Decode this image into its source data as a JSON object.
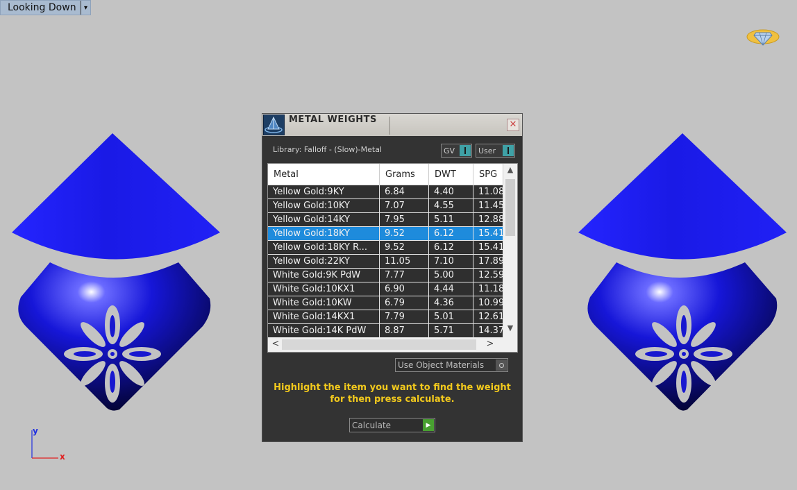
{
  "viewport": {
    "label": "Looking Down",
    "dropdown_glyph": "▾",
    "axis_x": "x",
    "axis_y": "y"
  },
  "icons": {
    "gem": "gem-icon",
    "app_logo": "app-logo-icon",
    "close": "close-icon"
  },
  "colors": {
    "object_blue": "#1a1ae6",
    "selected_row": "#1e8bdc",
    "hint_text": "#f2c91d",
    "go_green": "#48a030"
  },
  "dialog": {
    "title": "METAL WEIGHTS",
    "close_glyph": "✕",
    "library_label": "Library: Falloff - (Slow)-Metal",
    "toggle_gv": "GV",
    "toggle_user": "User",
    "columns": [
      "Metal",
      "Grams",
      "DWT",
      "SPG"
    ],
    "rows": [
      {
        "metal": "Yellow Gold:9KY",
        "grams": "6.84",
        "dwt": "4.40",
        "spg": "11.08",
        "selected": false
      },
      {
        "metal": "Yellow Gold:10KY",
        "grams": "7.07",
        "dwt": "4.55",
        "spg": "11.45",
        "selected": false
      },
      {
        "metal": "Yellow Gold:14KY",
        "grams": "7.95",
        "dwt": "5.11",
        "spg": "12.88",
        "selected": false
      },
      {
        "metal": "Yellow Gold:18KY",
        "grams": "9.52",
        "dwt": "6.12",
        "spg": "15.41",
        "selected": true
      },
      {
        "metal": "Yellow Gold:18KY R...",
        "grams": "9.52",
        "dwt": "6.12",
        "spg": "15.41",
        "selected": false
      },
      {
        "metal": "Yellow Gold:22KY",
        "grams": "11.05",
        "dwt": "7.10",
        "spg": "17.89",
        "selected": false
      },
      {
        "metal": "White Gold:9K PdW",
        "grams": "7.77",
        "dwt": "5.00",
        "spg": "12.59",
        "selected": false
      },
      {
        "metal": "White Gold:10KX1",
        "grams": "6.90",
        "dwt": "4.44",
        "spg": "11.18",
        "selected": false
      },
      {
        "metal": "White Gold:10KW",
        "grams": "6.79",
        "dwt": "4.36",
        "spg": "10.99",
        "selected": false
      },
      {
        "metal": "White Gold:14KX1",
        "grams": "7.79",
        "dwt": "5.01",
        "spg": "12.61",
        "selected": false
      },
      {
        "metal": "White Gold:14K PdW",
        "grams": "8.87",
        "dwt": "5.71",
        "spg": "14.37",
        "selected": false
      }
    ],
    "scroll_up": "▲",
    "scroll_down": "▼",
    "scroll_left": "<",
    "scroll_right": ">",
    "materials_dropdown": "Use Object Materials",
    "hint_line1": "Highlight the item you want to find the weight",
    "hint_line2": "for then press calculate.",
    "calculate_label": "Calculate",
    "calculate_glyph": "▶"
  }
}
